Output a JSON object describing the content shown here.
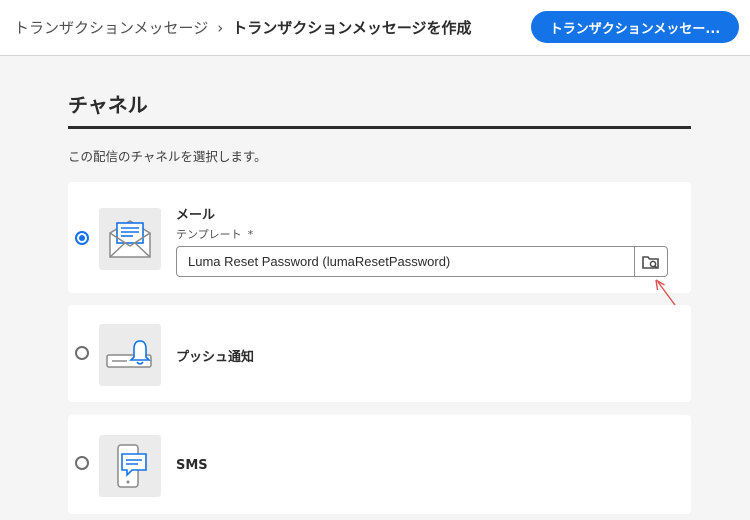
{
  "header": {
    "breadcrumb_parent": "トランザクションメッセージ",
    "breadcrumb_separator": "›",
    "breadcrumb_current": "トランザクションメッセージを作成",
    "primary_button_label": "トランザクションメッセー..."
  },
  "section": {
    "title": "チャネル",
    "description": "この配信のチャネルを選択します。"
  },
  "channels": [
    {
      "name": "メール",
      "icon": "email-envelope-icon",
      "selected": true,
      "template_label": "テンプレート",
      "template_required_mark": "*",
      "template_value": "Luma Reset Password (lumaResetPassword)",
      "template_picker_icon": "folder-search-icon"
    },
    {
      "name": "プッシュ通知",
      "icon": "push-bell-icon",
      "selected": false
    },
    {
      "name": "SMS",
      "icon": "sms-phone-icon",
      "selected": false
    }
  ],
  "colors": {
    "accent": "#1473e6",
    "annotation": "#d9534f"
  }
}
